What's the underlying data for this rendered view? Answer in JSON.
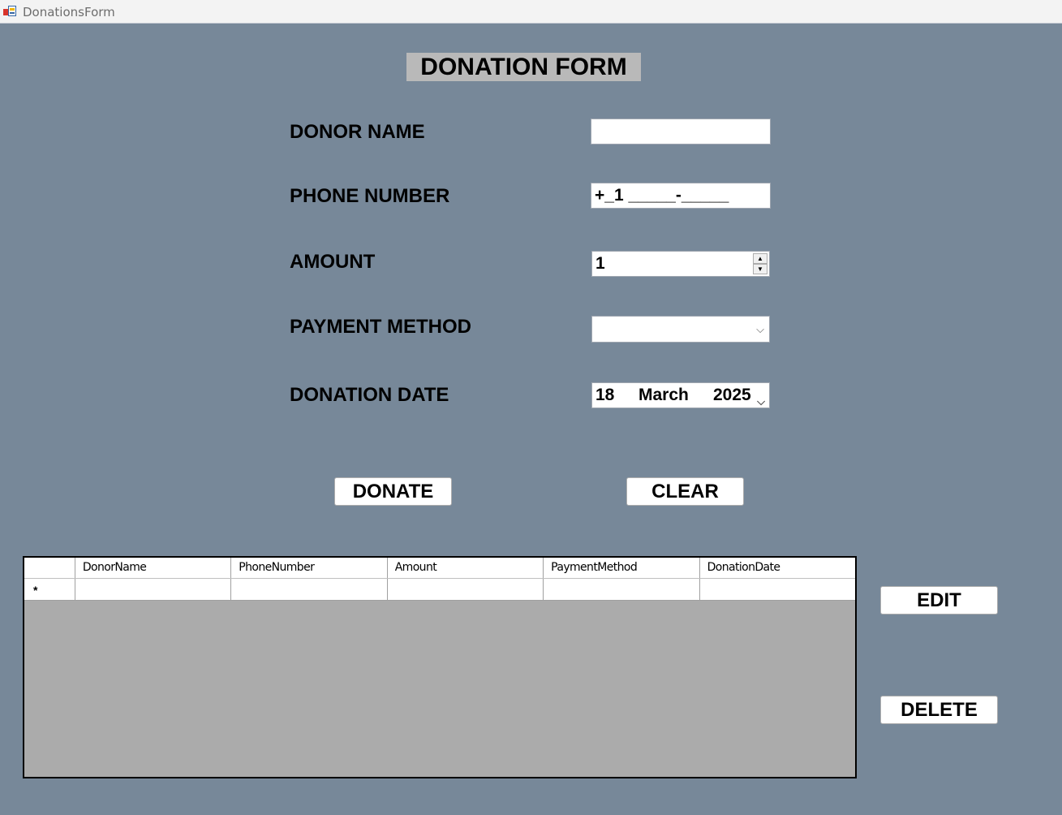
{
  "window": {
    "title": "DonationsForm"
  },
  "form": {
    "title": "DONATION FORM",
    "labels": {
      "donor_name": "DONOR NAME",
      "phone_number": "PHONE NUMBER",
      "amount": "AMOUNT",
      "payment_method": "PAYMENT METHOD",
      "donation_date": "DONATION DATE"
    },
    "values": {
      "donor_name": "",
      "phone_number": "+_1 _____-_____",
      "amount": "1",
      "payment_method": "",
      "date_day": "18",
      "date_month": "March",
      "date_year": "2025"
    }
  },
  "buttons": {
    "donate": "DONATE",
    "clear": "CLEAR",
    "edit": "EDIT",
    "delete": "DELETE"
  },
  "grid": {
    "columns": [
      "DonorName",
      "PhoneNumber",
      "Amount",
      "PaymentMethod",
      "DonationDate"
    ],
    "new_row_marker": "*"
  },
  "icons": {
    "spinner_up": "▲",
    "spinner_down": "▼",
    "dropdown": "⌵"
  }
}
